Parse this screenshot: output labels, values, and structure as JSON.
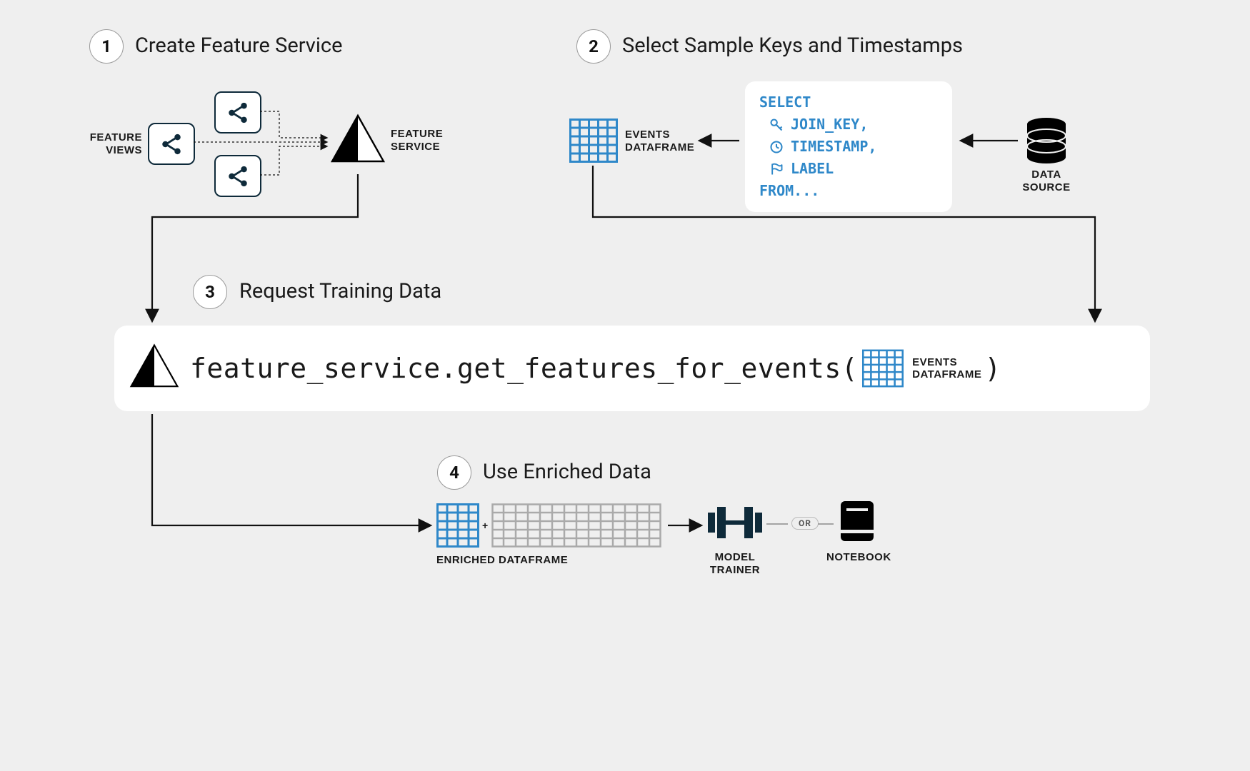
{
  "steps": {
    "s1": {
      "num": "1",
      "title": "Create Feature Service"
    },
    "s2": {
      "num": "2",
      "title": "Select Sample Keys and Timestamps"
    },
    "s3": {
      "num": "3",
      "title": "Request Training Data"
    },
    "s4": {
      "num": "4",
      "title": "Use Enriched Data"
    }
  },
  "labels": {
    "feature_views_l1": "FEATURE",
    "feature_views_l2": "VIEWS",
    "feature_service_l1": "FEATURE",
    "feature_service_l2": "SERVICE",
    "events_df_l1": "EVENTS",
    "events_df_l2": "DATAFRAME",
    "data_source_l1": "DATA",
    "data_source_l2": "SOURCE",
    "enriched_df": "ENRICHED DATAFRAME",
    "model_trainer_l1": "MODEL",
    "model_trainer_l2": "TRAINER",
    "notebook": "NOTEBOOK",
    "or": "OR",
    "plus": "+"
  },
  "sql": {
    "select": "SELECT",
    "join_key": "JOIN_KEY,",
    "timestamp": "TIMESTAMP,",
    "label": "LABEL",
    "from": "FROM..."
  },
  "code": {
    "call": "feature_service.get_features_for_events(",
    "close": ")"
  },
  "colors": {
    "blue": "#2f88c9",
    "dark": "#0e2a3a"
  }
}
